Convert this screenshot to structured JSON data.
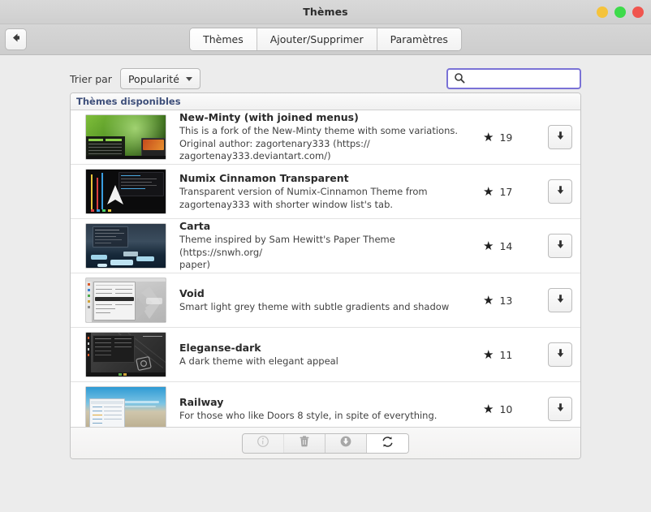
{
  "window": {
    "title": "Thèmes",
    "buttons": [
      {
        "name": "minimize",
        "color": "#f5c33b"
      },
      {
        "name": "maximize",
        "color": "#3ddb4a"
      },
      {
        "name": "close",
        "color": "#f0554e"
      }
    ]
  },
  "header": {
    "back_icon": "arrow-left-icon",
    "tabs": [
      {
        "label": "Thèmes",
        "active": true
      },
      {
        "label": "Ajouter/Supprimer",
        "active": false
      },
      {
        "label": "Paramètres",
        "active": false
      }
    ]
  },
  "toolbar": {
    "sort_label": "Trier par",
    "sort_value": "Popularité",
    "search_placeholder": "",
    "search_value": "",
    "search_icon": "search-icon"
  },
  "list": {
    "header": "Thèmes disponibles",
    "rows": [
      {
        "title": "New-Minty (with joined menus)",
        "description": "This is a fork of the New-Minty theme with some variations.\nOriginal author: zagortenary333 (https://\nzagortenay333.deviantart.com/)",
        "score": "19",
        "star_icon": "star-icon",
        "download_icon": "download-arrow-icon"
      },
      {
        "title": "Numix Cinnamon Transparent",
        "description": "Transparent version of Numix-Cinnamon Theme from\nzagortenay333 with shorter window list's tab.",
        "score": "17",
        "star_icon": "star-icon",
        "download_icon": "download-arrow-icon"
      },
      {
        "title": "Carta",
        "description": "Theme inspired by Sam Hewitt's Paper Theme (https://snwh.org/\npaper)",
        "score": "14",
        "star_icon": "star-icon",
        "download_icon": "download-arrow-icon"
      },
      {
        "title": "Void",
        "description": "Smart light grey theme with subtle gradients and shadow",
        "score": "13",
        "star_icon": "star-icon",
        "download_icon": "download-arrow-icon"
      },
      {
        "title": "Eleganse-dark",
        "description": "A dark theme with elegant appeal",
        "score": "11",
        "star_icon": "star-icon",
        "download_icon": "download-arrow-icon"
      },
      {
        "title": "Railway",
        "description": "For those who like Doors 8 style, in spite of everything.",
        "score": "10",
        "star_icon": "star-icon",
        "download_icon": "download-arrow-icon"
      }
    ]
  },
  "footer": {
    "actions": [
      {
        "name": "info-icon",
        "state": "disabled"
      },
      {
        "name": "trash-icon",
        "state": "normal"
      },
      {
        "name": "download-circle-icon",
        "state": "normal"
      },
      {
        "name": "refresh-icon",
        "state": "active"
      }
    ]
  }
}
